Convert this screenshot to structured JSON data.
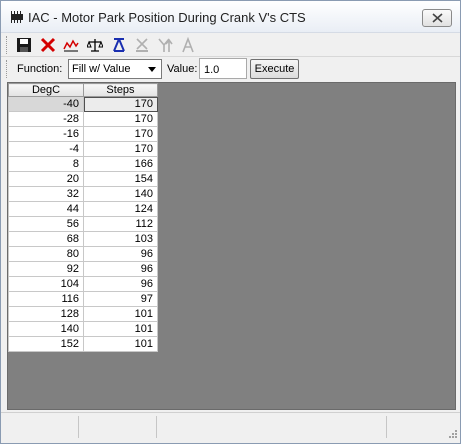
{
  "window": {
    "title": "IAC - Motor Park Position During Crank V's CTS",
    "close_symbol": "✕"
  },
  "toolbar": {
    "icons": [
      "save-icon",
      "delete-icon",
      "graph-icon",
      "scale-icon",
      "interpolate-icon",
      "cut-icon",
      "up-icon",
      "text-icon"
    ],
    "accent_red": "#d40000",
    "accent_blue": "#1a2fb0"
  },
  "function_bar": {
    "function_label": "Function:",
    "function_selected": "Fill w/ Value",
    "value_label": "Value:",
    "value": "1.0",
    "execute_label": "Execute"
  },
  "table": {
    "headers": [
      "DegC",
      "Steps"
    ],
    "selected_row": 0,
    "rows": [
      [
        "-40",
        "170"
      ],
      [
        "-28",
        "170"
      ],
      [
        "-16",
        "170"
      ],
      [
        "-4",
        "170"
      ],
      [
        "8",
        "166"
      ],
      [
        "20",
        "154"
      ],
      [
        "32",
        "140"
      ],
      [
        "44",
        "124"
      ],
      [
        "56",
        "112"
      ],
      [
        "68",
        "103"
      ],
      [
        "80",
        "96"
      ],
      [
        "92",
        "96"
      ],
      [
        "104",
        "96"
      ],
      [
        "116",
        "97"
      ],
      [
        "128",
        "101"
      ],
      [
        "140",
        "101"
      ],
      [
        "152",
        "101"
      ]
    ]
  }
}
